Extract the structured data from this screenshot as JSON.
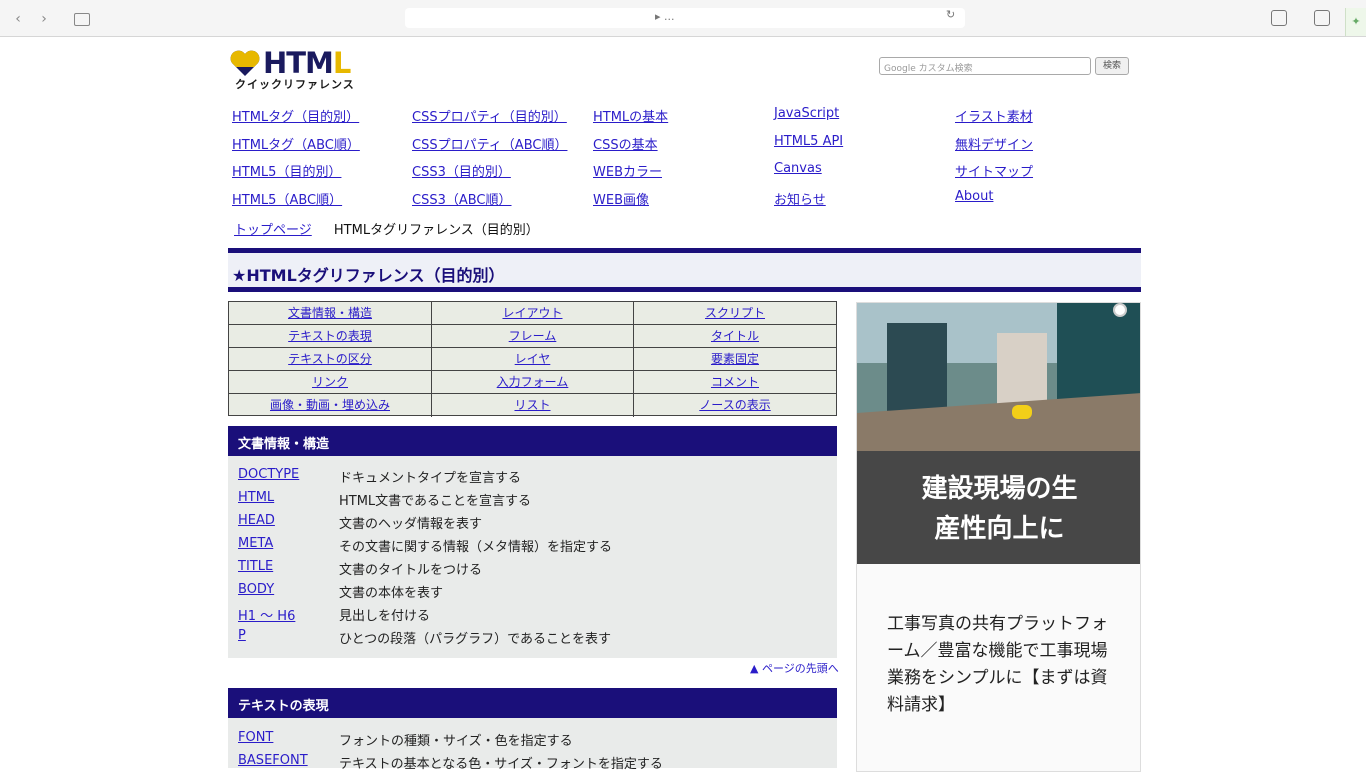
{
  "browser": {
    "back": "‹",
    "forward": "›",
    "url": "▸ ...",
    "reload": "↻"
  },
  "logo": {
    "word_a": "HTM",
    "word_b": "L",
    "sub": "クイックリファレンス"
  },
  "search": {
    "placeholder": "Google カスタム検索",
    "button": "検索"
  },
  "nav": [
    {
      "label": "HTMLタグ（目的別）"
    },
    {
      "label": "CSSプロパティ（目的別）"
    },
    {
      "label": "HTMLの基本"
    },
    {
      "label": "JavaScript"
    },
    {
      "label": "イラスト素材"
    },
    {
      "label": "HTMLタグ（ABC順）"
    },
    {
      "label": "CSSプロパティ（ABC順）"
    },
    {
      "label": "CSSの基本"
    },
    {
      "label": "HTML5 API"
    },
    {
      "label": "無料デザイン"
    },
    {
      "label": "HTML5（目的別）"
    },
    {
      "label": "CSS3（目的別）"
    },
    {
      "label": "WEBカラー"
    },
    {
      "label": "Canvas"
    },
    {
      "label": "サイトマップ"
    },
    {
      "label": "HTML5（ABC順）"
    },
    {
      "label": "CSS3（ABC順）"
    },
    {
      "label": "WEB画像"
    },
    {
      "label": "お知らせ"
    },
    {
      "label": "About"
    }
  ],
  "breadcrumb": {
    "home": "トップページ",
    "current": "HTMLタグリファレンス（目的別）"
  },
  "title": "★HTMLタグリファレンス（目的別）",
  "categories": [
    "文書情報・構造",
    "レイアウト",
    "スクリプト",
    "テキストの表現",
    "フレーム",
    "タイトル",
    "テキストの区分",
    "レイヤ",
    "要素固定",
    "リンク",
    "入力フォーム",
    "コメント",
    "画像・動画・埋め込み",
    "リスト",
    "ノースの表示"
  ],
  "section1": {
    "heading": "文書情報・構造",
    "rows": [
      {
        "tag": "DOCTYPE",
        "desc": "ドキュメントタイプを宣言する"
      },
      {
        "tag": "HTML",
        "desc": "HTML文書であることを宣言する"
      },
      {
        "tag": "HEAD",
        "desc": "文書のヘッダ情報を表す"
      },
      {
        "tag": "META",
        "desc": "その文書に関する情報（メタ情報）を指定する"
      },
      {
        "tag": "TITLE",
        "desc": "文書のタイトルをつける"
      },
      {
        "tag": "BODY",
        "desc": "文書の本体を表す"
      },
      {
        "tag": "H1 ～ H6",
        "desc": "見出しを付ける"
      },
      {
        "tag": "P",
        "desc": "ひとつの段落（パラグラフ）であることを表す"
      }
    ]
  },
  "back_to_top": "▲ ページの先頭へ",
  "section2": {
    "heading": "テキストの表現",
    "rows": [
      {
        "tag": "FONT",
        "desc": "フォントの種類・サイズ・色を指定する"
      },
      {
        "tag": "BASEFONT",
        "desc": "テキストの基本となる色・サイズ・フォントを指定する"
      }
    ]
  },
  "ad": {
    "headline_1": "建設現場の生",
    "headline_2": "産性向上に",
    "body": "工事写真の共有プラットフォーム／豊富な機能で工事現場業務をシンプルに【まずは資料請求】"
  },
  "colors": {
    "accent": "#1a0f7a",
    "link": "#2a1cc9",
    "logo_yellow": "#e7b800"
  }
}
